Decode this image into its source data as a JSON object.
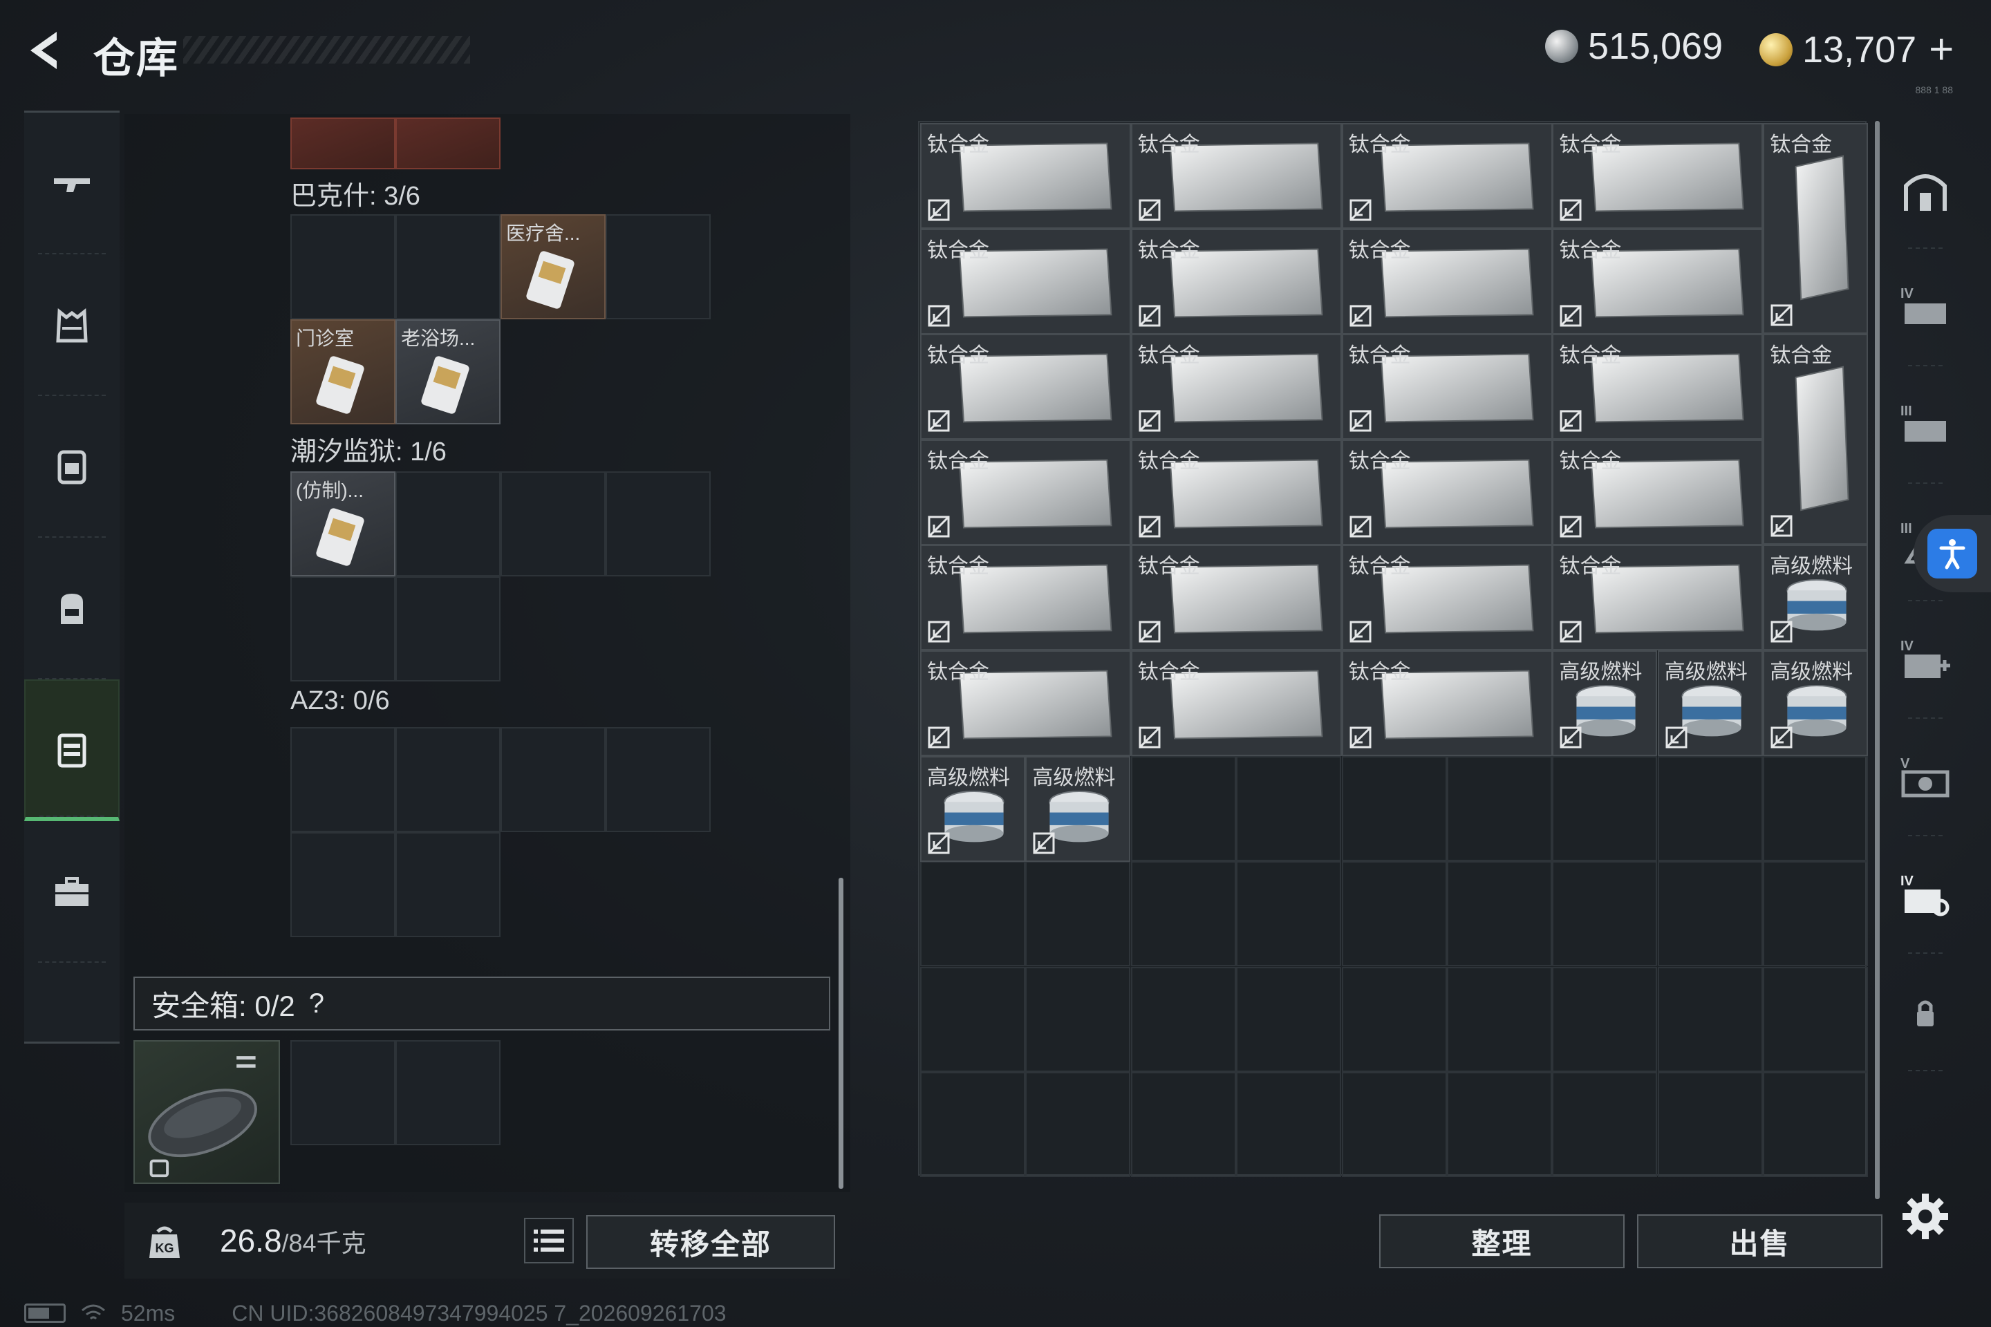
{
  "header": {
    "title": "仓库",
    "currency_primary": "515,069",
    "currency_secondary": "13,707",
    "add_symbol": "+",
    "corner_text": "888 1 88"
  },
  "left_nav": {
    "items": [
      "firearms",
      "armor",
      "chest-rig",
      "backpack",
      "container",
      "case"
    ],
    "active": "container"
  },
  "containers": {
    "top_cells": [
      "",
      ""
    ],
    "sections": [
      {
        "title": "巴克什: 3/6",
        "items": [
          "医疗舍...",
          "门诊室",
          "老浴场..."
        ]
      },
      {
        "title": "潮汐监狱: 1/6",
        "items": [
          "(仿制)..."
        ]
      },
      {
        "title": "AZ3: 0/6",
        "items": []
      }
    ],
    "safebox": {
      "label": "安全箱: 0/2",
      "help": "?"
    }
  },
  "weight": {
    "current": "26.8",
    "max": "/84千克"
  },
  "buttons": {
    "transfer_all": "转移全部",
    "sort": "整理",
    "sell": "出售"
  },
  "stash": {
    "items": [
      {
        "label": "钛合金"
      },
      {
        "label": "钛合金"
      },
      {
        "label": "钛合金"
      },
      {
        "label": "钛合金"
      },
      {
        "label": "钛合金"
      },
      {
        "label": "钛合金"
      },
      {
        "label": "钛合金"
      },
      {
        "label": "钛合金"
      },
      {
        "label": "钛合金"
      },
      {
        "label": "钛合金"
      },
      {
        "label": "钛合金"
      },
      {
        "label": "钛合金"
      },
      {
        "label": "钛合金"
      },
      {
        "label": "钛合金"
      },
      {
        "label": "钛合金"
      },
      {
        "label": "钛合金"
      },
      {
        "label": "钛合金"
      },
      {
        "label": "钛合金"
      },
      {
        "label": "钛合金"
      },
      {
        "label": "钛合金"
      },
      {
        "label": "钛合金"
      },
      {
        "label": "钛合金"
      },
      {
        "label": "高级燃料"
      },
      {
        "label": "钛合金"
      },
      {
        "label": "钛合金"
      },
      {
        "label": "钛合金"
      },
      {
        "label": "高级燃料"
      },
      {
        "label": "高级燃料"
      },
      {
        "label": "高级燃料"
      },
      {
        "label": "高级燃料"
      },
      {
        "label": "高级燃料"
      }
    ]
  },
  "rail": {
    "tiers": [
      "IV",
      "III",
      "III",
      "IV",
      "V",
      "IV"
    ]
  },
  "status": {
    "ping": "52ms",
    "uid": "CN UID:3682608497347994025 7_202609261703"
  }
}
